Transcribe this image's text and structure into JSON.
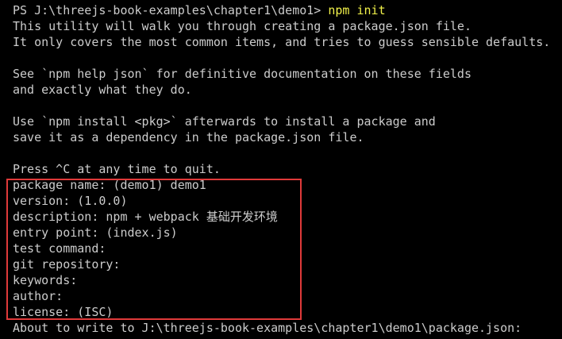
{
  "terminal": {
    "prompt": {
      "path": "PS J:\\threejs-book-examples\\chapter1\\demo1> ",
      "command": "npm init"
    },
    "intro": [
      "This utility will walk you through creating a package.json file.",
      "It only covers the most common items, and tries to guess sensible defaults.",
      "See `npm help json` for definitive documentation on these fields",
      "and exactly what they do.",
      "Use `npm install <pkg>` afterwards to install a package and",
      "save it as a dependency in the package.json file.",
      "Press ^C at any time to quit."
    ],
    "fields": [
      "package name: (demo1) demo1",
      "version: (1.0.0)",
      "description: npm + webpack 基础开发环境",
      "entry point: (index.js)",
      "test command:",
      "git repository:",
      "keywords:",
      "author:",
      "license: (ISC)"
    ],
    "footer": "About to write to J:\\threejs-book-examples\\chapter1\\demo1\\package.json:",
    "colors": {
      "background": "#000000",
      "text": "#cccccc",
      "command": "#f1f14a",
      "highlight": "#e03a3a"
    }
  }
}
